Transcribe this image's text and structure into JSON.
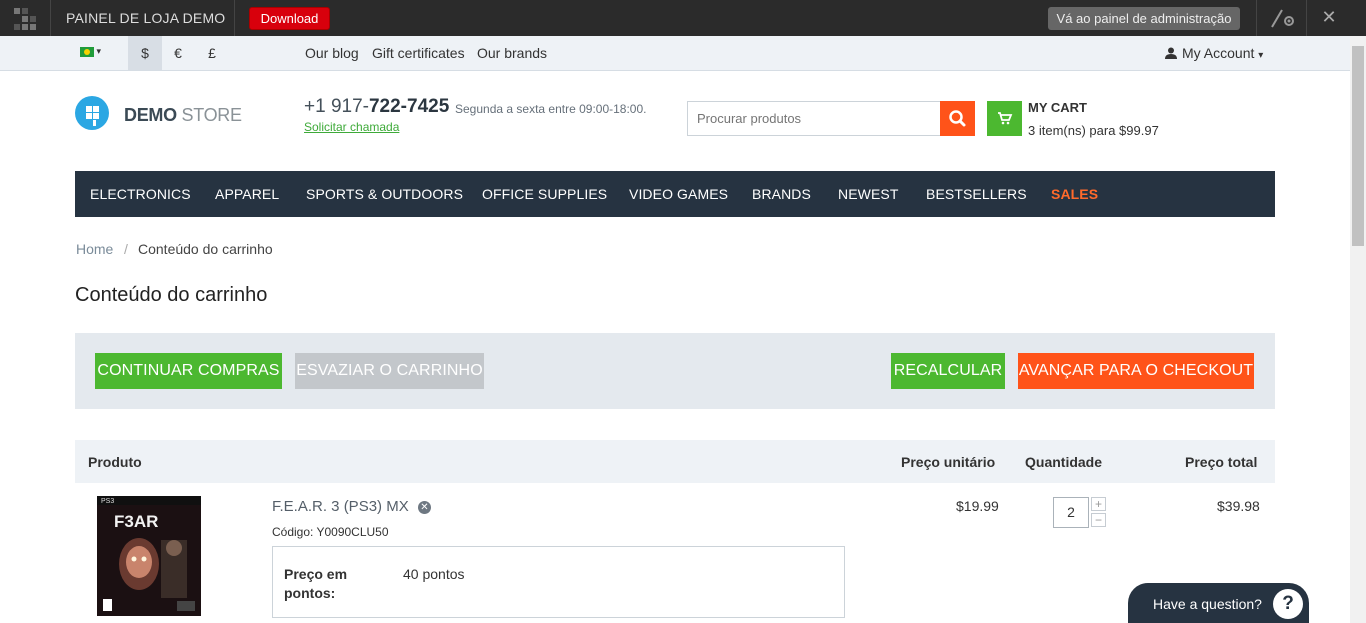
{
  "admin_bar": {
    "title": "PAINEL DE LOJA DEMO",
    "download_label": "Download",
    "admin_panel_label": "Vá ao painel de administração",
    "close_glyph": "✕"
  },
  "top_bar": {
    "currencies": [
      "$",
      "€",
      "£"
    ],
    "links": [
      "Our blog",
      "Gift certificates",
      "Our brands"
    ],
    "account_label": "My Account"
  },
  "header": {
    "logo_bold": "DEMO",
    "logo_light": " STORE",
    "phone_prefix": "+1 917-",
    "phone_number": "722-7425",
    "hours": "Segunda a sexta entre 09:00-18:00.",
    "callback": "Solicitar chamada",
    "search_placeholder": "Procurar produtos",
    "cart_title": "MY CART",
    "cart_summary": "3 item(ns) para $99.97"
  },
  "nav": {
    "items": [
      "ELECTRONICS",
      "APPAREL",
      "SPORTS & OUTDOORS",
      "OFFICE SUPPLIES",
      "VIDEO GAMES",
      "BRANDS",
      "NEWEST",
      "BESTSELLERS",
      "SALES"
    ]
  },
  "breadcrumb": {
    "home": "Home",
    "separator": "/",
    "current": "Conteúdo do carrinho"
  },
  "page_title": "Conteúdo do carrinho",
  "actions": {
    "continue": "CONTINUAR COMPRAS",
    "clear": "ESVAZIAR O CARRINHO",
    "recalculate": "RECALCULAR",
    "checkout": "AVANÇAR PARA O CHECKOUT"
  },
  "table": {
    "headers": {
      "product": "Produto",
      "unit_price": "Preço unitário",
      "quantity": "Quantidade",
      "total": "Preço total"
    },
    "rows": [
      {
        "name": "F.E.A.R. 3 (PS3) MX",
        "code": "Código: Y0090CLU50",
        "points_label": "Preço em pontos:",
        "points_value": "40 pontos",
        "unit_price": "$19.99",
        "quantity": "2",
        "total": "$39.98",
        "image_platform": "PS3",
        "image_title": "F3AR"
      }
    ]
  },
  "chat": {
    "label": "Have a question?",
    "icon": "?"
  },
  "colors": {
    "admin_bg": "#2b2b2b",
    "nav_bg": "#263341",
    "accent_orange": "#ff5319",
    "accent_green": "#4cb830",
    "logo_blue": "#2ba7e3"
  }
}
